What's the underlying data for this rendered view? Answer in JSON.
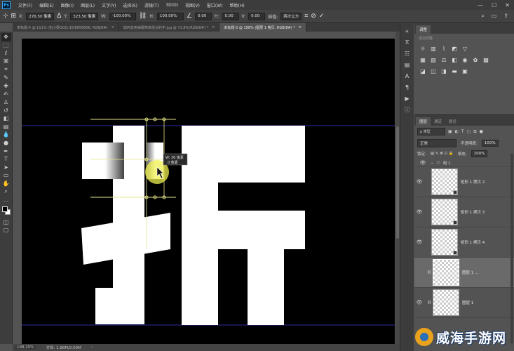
{
  "app": {
    "logo": "Ps"
  },
  "menubar": {
    "items": [
      "文件(F)",
      "编辑(E)",
      "图像(I)",
      "图层(L)",
      "文字(Y)",
      "选择(S)",
      "滤镜(T)",
      "3D(D)",
      "视图(V)",
      "窗口(W)",
      "帮助(H)"
    ],
    "controls": [
      "minimize-icon",
      "maximize-icon",
      "close-icon"
    ]
  },
  "options": {
    "x_label": "X:",
    "x_value": "276.50 像素",
    "y_label": "Y:",
    "y_value": "323.50 像素",
    "w_label": "W:",
    "w_value": "-100.00%",
    "h_label": "H:",
    "h_value": "100.00%",
    "angle_value": "0.00",
    "hskew_label": "H:",
    "hskew_value": "0.00",
    "vskew_label": "V:",
    "vskew_value": "0.00",
    "interp_label": "插值:",
    "interp_value": "两次立方"
  },
  "tabs": [
    {
      "label": "未标题-4 @ 111% (扣小梁QQQ.36/8656806, RGB/8#)",
      "active": false
    },
    {
      "label": "如何去用海报简单组合的字.jpg @ 71.8%(RGB/8#) *",
      "active": false
    },
    {
      "label": "未标题-5 @ 198% (图层 1 拷贝, RGB/8#) *",
      "active": true
    }
  ],
  "transform_readout": {
    "line1": "W: 36 像素",
    "line2": "0 像素"
  },
  "status": {
    "zoom": "198.25%",
    "doc": "文档: 1.88M/2.00M"
  },
  "adjust_panel": {
    "tabs": [
      "调整"
    ],
    "subtitle": "添加调整",
    "rows": [
      [
        "brightness-icon",
        "levels-icon",
        "curves-icon",
        "exposure-icon",
        "triangle-icon"
      ],
      [
        "vibrance-icon",
        "hue-icon",
        "balance-icon",
        "bw-icon",
        "photo-filter-icon",
        "mixer-icon",
        "lookup-icon"
      ],
      [
        "invert-icon",
        "posterize-icon",
        "threshold-icon",
        "gradient-map-icon",
        "selective-color-icon"
      ]
    ]
  },
  "layers_panel": {
    "tabs": [
      "图层",
      "通道",
      "路径"
    ],
    "kind_filter": "ρ 类型",
    "blend_mode": "正常",
    "opacity_label": "不透明度:",
    "opacity_value": "100%",
    "lock_label": "锁定:",
    "fill_label": "填充:",
    "fill_value": "100%",
    "group_name": "组 1",
    "layers": [
      {
        "name": "矩形 1 拷贝 2",
        "selected": false
      },
      {
        "name": "矩形 1 拷贝 3",
        "selected": false
      },
      {
        "name": "矩形 1 拷贝 4",
        "selected": false
      },
      {
        "name": "图层 1 ...",
        "selected": true
      },
      {
        "name": "图层 1",
        "selected": false
      }
    ]
  },
  "watermark": {
    "text": "威海手游网"
  },
  "colors": {
    "canvas": "#000000",
    "shapes": "#ffffff",
    "guide": "#3a3ad0",
    "transform_box": "#e6e68a",
    "cursor_highlight": "#f0f050"
  }
}
